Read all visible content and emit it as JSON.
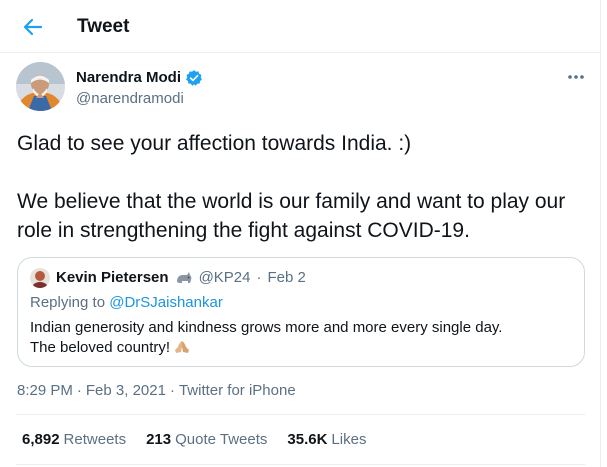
{
  "header": {
    "title": "Tweet",
    "back_icon": "arrow-left-icon"
  },
  "author": {
    "name": "Narendra Modi",
    "handle": "@narendramodi",
    "verified": true,
    "accent": "#1da1f2"
  },
  "tweet": {
    "paragraph1": "Glad to see your affection towards India. :)",
    "paragraph2": "We believe that the world is our family and want to play our role in strengthening the fight against COVID-19."
  },
  "quote": {
    "name": "Kevin Pietersen",
    "handle": "@KP24",
    "separator": "·",
    "date": "Feb 2",
    "replying_prefix": "Replying to ",
    "replying_to": "@DrSJaishankar",
    "line1": "Indian generosity and kindness grows more and more every single day.",
    "line2": "The beloved country!"
  },
  "meta": {
    "time": "8:29 PM",
    "sep1": "·",
    "date": "Feb 3, 2021",
    "sep2": "·",
    "source": "Twitter for iPhone"
  },
  "stats": [
    {
      "number": "6,892",
      "label": "Retweets"
    },
    {
      "number": "213",
      "label": "Quote Tweets"
    },
    {
      "number": "35.6K",
      "label": "Likes"
    }
  ]
}
